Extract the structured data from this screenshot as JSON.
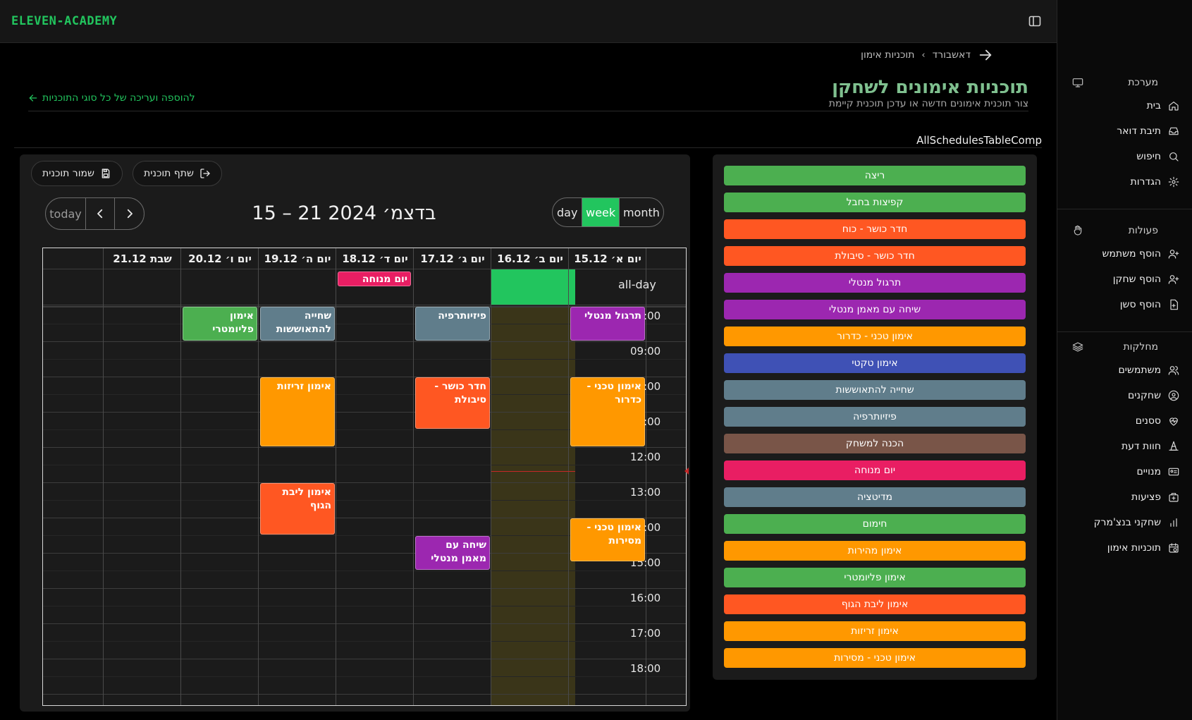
{
  "app": {
    "brand": "ELEVEN-ACADEMY"
  },
  "breadcrumb": {
    "home": "דאשבורד",
    "current": "תוכניות אימון"
  },
  "page": {
    "title": "תוכניות אימונים לשחקן",
    "subtitle": "צור תוכנית אימונים חדשה או עדכן תוכנית קיימת",
    "add_link": "להוספה ועריכה של כל סוגי התוכניות",
    "component_label": "AllSchedulesTableComp"
  },
  "sidebar": {
    "system": {
      "label": "מערכת",
      "items": [
        {
          "label": "בית",
          "icon": "home-icon"
        },
        {
          "label": "תיבת דואר",
          "icon": "inbox-icon"
        },
        {
          "label": "חיפוש",
          "icon": "search-icon"
        },
        {
          "label": "הגדרות",
          "icon": "gear-icon"
        }
      ]
    },
    "actions": {
      "label": "פעולות",
      "items": [
        {
          "label": "הוסף משתמש",
          "icon": "user-plus-icon"
        },
        {
          "label": "הוסף שחקן",
          "icon": "user-plus-icon"
        },
        {
          "label": "הוסף סשן",
          "icon": "file-plus-icon"
        }
      ]
    },
    "departments": {
      "label": "מחלקות",
      "items": [
        {
          "label": "משתמשים",
          "icon": "users-icon"
        },
        {
          "label": "שחקנים",
          "icon": "user-circle-icon"
        },
        {
          "label": "ססנים",
          "icon": "heart-pulse-icon"
        },
        {
          "label": "חוות דעת",
          "icon": "cone-icon"
        },
        {
          "label": "מנויים",
          "icon": "id-card-icon"
        },
        {
          "label": "פציעות",
          "icon": "medical-kit-icon"
        },
        {
          "label": "שחקני בנצ'מרק",
          "icon": "bar-chart-icon"
        },
        {
          "label": "תוכניות אימון",
          "icon": "calendar-clock-icon"
        }
      ]
    }
  },
  "toolbar": {
    "save_label": "שמור תוכנית",
    "share_label": "שתף תוכנית"
  },
  "calendar": {
    "title": "15 – 21 בדצמ׳ 2024",
    "today_label": "today",
    "views": {
      "day": "day",
      "week": "week",
      "month": "month"
    },
    "active_view": "week",
    "allday_label": "all-day",
    "days": [
      "יום א׳ 15.12",
      "יום ב׳ 16.12",
      "יום ג׳ 17.12",
      "יום ד׳ 18.12",
      "יום ה׳ 19.12",
      "יום ו׳ 20.12",
      "שבת 21.12"
    ],
    "today_index": 1,
    "times": [
      "08:00",
      "09:00",
      "10:00",
      "11:00",
      "12:00",
      "13:00",
      "14:00",
      "15:00",
      "16:00",
      "17:00",
      "18:00"
    ],
    "allday_events": [
      {
        "day": 3,
        "title": "יום מנוחה",
        "color": "#e91e63"
      }
    ],
    "events": [
      {
        "day": 0,
        "start": "08:00",
        "end": "09:00",
        "title": "תרגול מנטלי",
        "color": "#9c27b0"
      },
      {
        "day": 0,
        "start": "10:00",
        "end": "12:00",
        "title": "אימון טכני - כדרור",
        "color": "#ff9800"
      },
      {
        "day": 0,
        "start": "14:00",
        "end": "15:15",
        "title": "אימון טכני - מסירות",
        "color": "#ff9800"
      },
      {
        "day": 2,
        "start": "08:00",
        "end": "09:00",
        "title": "פיזיותרפיה",
        "color": "#607d8b"
      },
      {
        "day": 2,
        "start": "10:00",
        "end": "11:30",
        "title": "חדר כושר - סיבולת",
        "color": "#ff5722"
      },
      {
        "day": 2,
        "start": "14:30",
        "end": "15:30",
        "title": "שיחה עם מאמן מנטלי",
        "color": "#9c27b0"
      },
      {
        "day": 4,
        "start": "08:00",
        "end": "09:00",
        "title": "שחייה להתאוששות",
        "color": "#607d8b"
      },
      {
        "day": 4,
        "start": "10:00",
        "end": "12:00",
        "title": "אימון זריזות",
        "color": "#ff9800"
      },
      {
        "day": 4,
        "start": "13:00",
        "end": "14:30",
        "title": "אימון ליבת הגוף",
        "color": "#ff5722"
      },
      {
        "day": 5,
        "start": "08:00",
        "end": "09:00",
        "title": "אימון פליומטרי",
        "color": "#4caf50"
      }
    ]
  },
  "event_types": [
    {
      "label": "ריצה",
      "color": "#4caf50"
    },
    {
      "label": "קפיצות בחבל",
      "color": "#4caf50"
    },
    {
      "label": "חדר כושר - כוח",
      "color": "#ff5722"
    },
    {
      "label": "חדר כושר - סיבולת",
      "color": "#ff5722"
    },
    {
      "label": "תרגול מנטלי",
      "color": "#9c27b0"
    },
    {
      "label": "שיחה עם מאמן מנטלי",
      "color": "#9c27b0"
    },
    {
      "label": "אימון טכני - כדרור",
      "color": "#ff9800"
    },
    {
      "label": "אימון טקטי",
      "color": "#3f51b5"
    },
    {
      "label": "שחייה להתאוששות",
      "color": "#607d8b"
    },
    {
      "label": "פיזיותרפיה",
      "color": "#607d8b"
    },
    {
      "label": "הכנה למשחק",
      "color": "#795548"
    },
    {
      "label": "יום מנוחה",
      "color": "#e91e63"
    },
    {
      "label": "מדיטציה",
      "color": "#607d8b"
    },
    {
      "label": "חימום",
      "color": "#4caf50"
    },
    {
      "label": "אימון מהירות",
      "color": "#ff9800"
    },
    {
      "label": "אימון פליומטרי",
      "color": "#4caf50"
    },
    {
      "label": "אימון ליבת הגוף",
      "color": "#ff5722"
    },
    {
      "label": "אימון זריזות",
      "color": "#ff9800"
    },
    {
      "label": "אימון טכני - מסירות",
      "color": "#ff9800"
    }
  ]
}
